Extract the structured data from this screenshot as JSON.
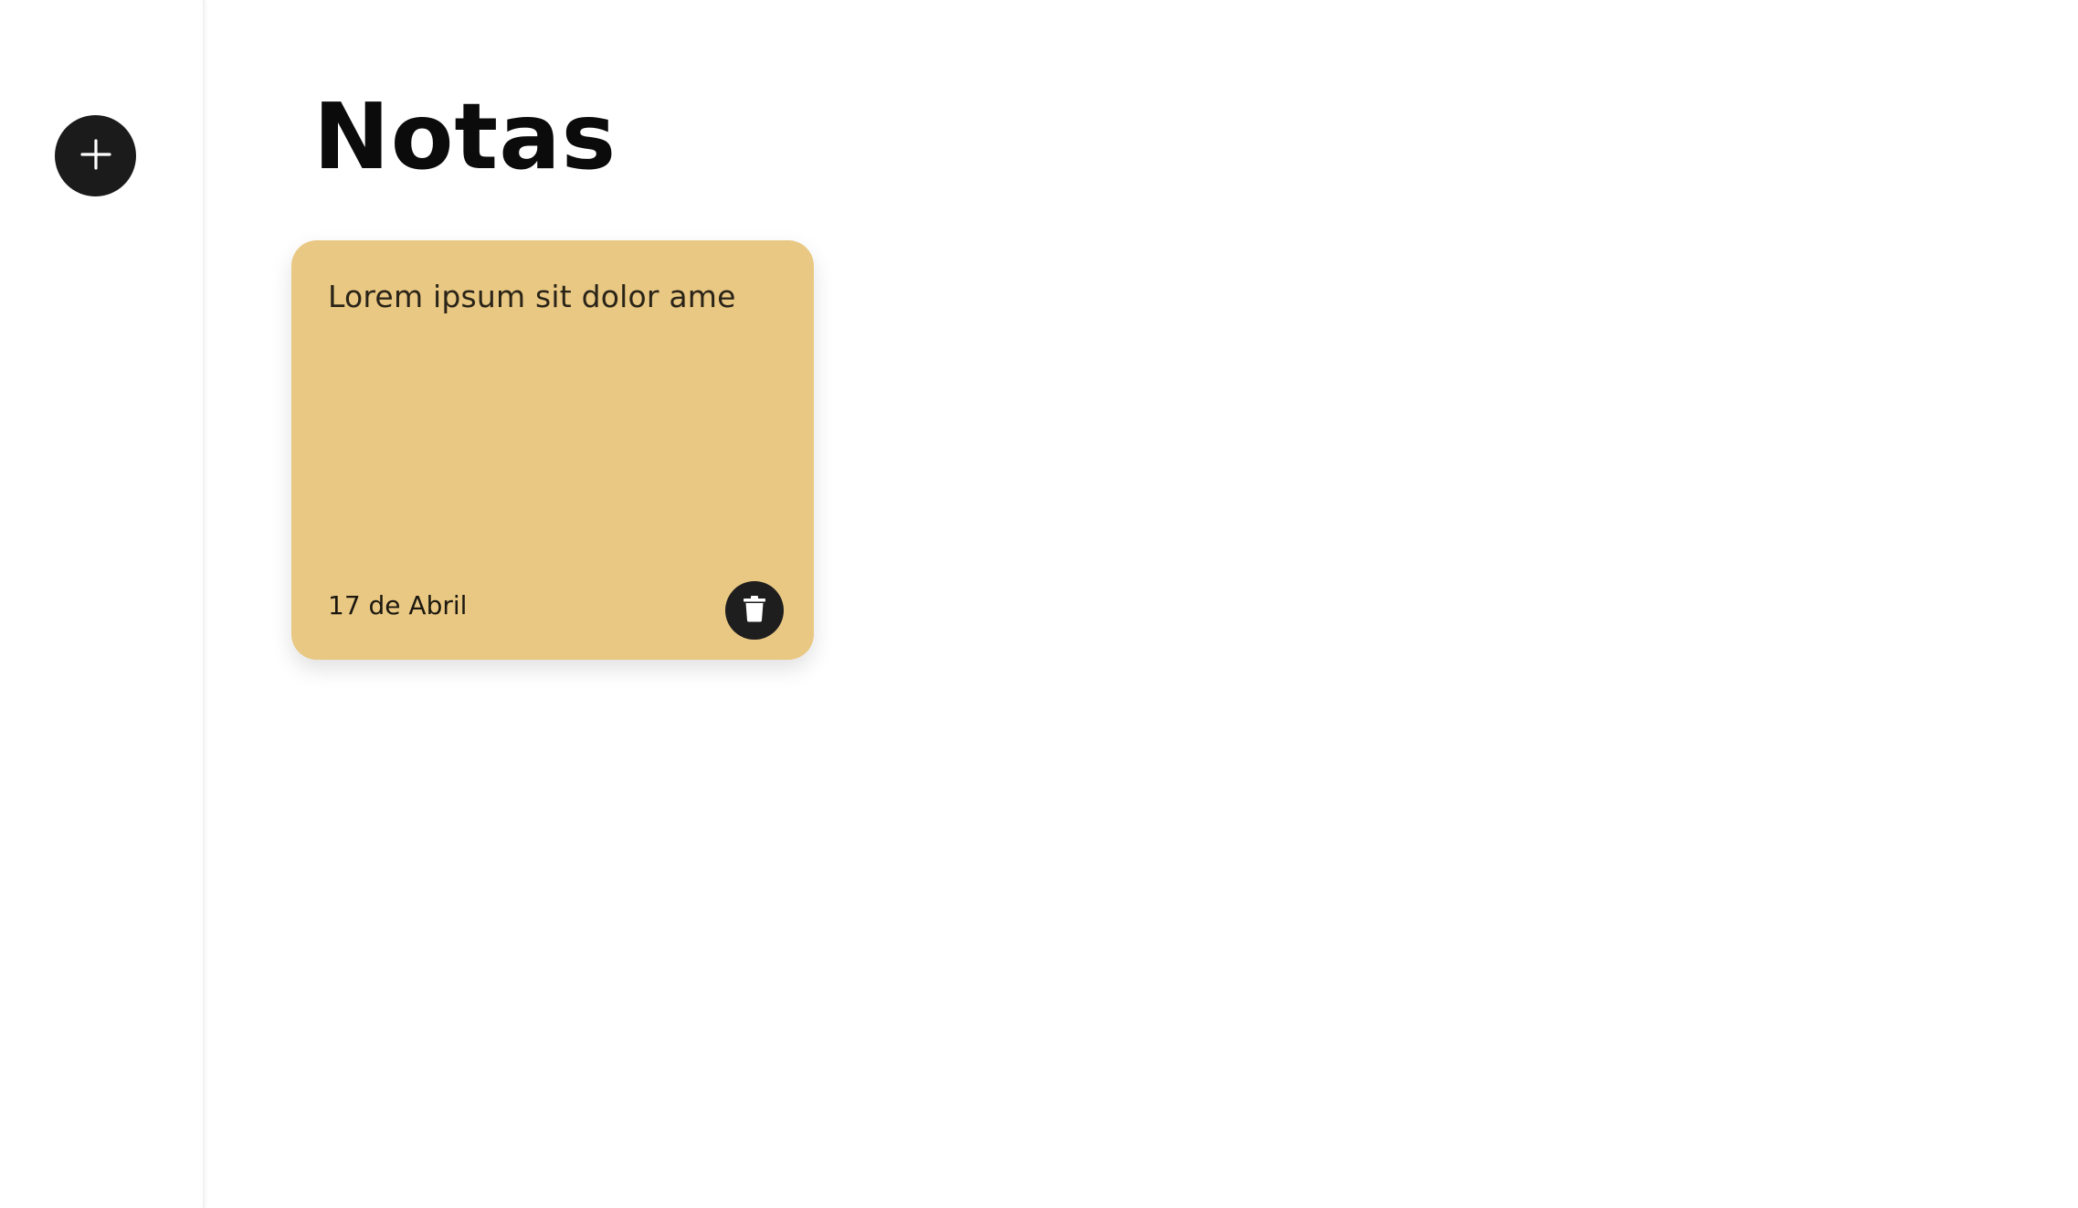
{
  "sidebar": {
    "add_button_icon": "plus-icon"
  },
  "main": {
    "title": "Notas"
  },
  "notes": [
    {
      "text": "Lorem ipsum sit dolor ame",
      "date": "17 de Abril",
      "color": "#e9c883",
      "delete_icon": "trash-icon"
    }
  ],
  "colors": {
    "button_bg": "#1b1b1b",
    "note_yellow": "#e9c883"
  }
}
